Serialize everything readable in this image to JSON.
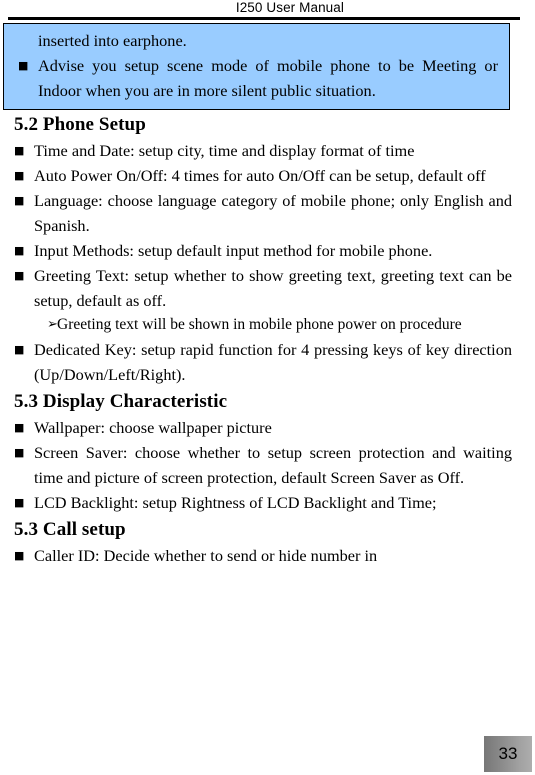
{
  "header": {
    "title": "I250 User Manual"
  },
  "callout": {
    "continuation_text": "inserted into earphone.",
    "bullet_marker": "■",
    "items": [
      "Advise you setup scene mode of mobile phone to be Meeting or Indoor when you are in more silent public situation."
    ]
  },
  "sections": [
    {
      "heading": "5.2 Phone Setup",
      "items": [
        {
          "marker": "■",
          "text": "Time and Date: setup city, time and display format of time"
        },
        {
          "marker": "■",
          "text": "Auto Power On/Off: 4 times for auto On/Off can be setup, default off"
        },
        {
          "marker": "■",
          "text": "Language: choose language category of mobile phone; only English and Spanish."
        },
        {
          "marker": "■",
          "text": "Input Methods: setup default input method for mobile phone."
        },
        {
          "marker": "■",
          "text": "Greeting Text: setup whether to show greeting text, greeting text can be setup, default as off.",
          "subitems": [
            {
              "marker": "➢",
              "text": "Greeting text will be shown in mobile phone power on procedure"
            }
          ]
        },
        {
          "marker": "■",
          "text": "Dedicated Key: setup rapid function for 4 pressing keys of key direction (Up/Down/Left/Right)."
        }
      ]
    },
    {
      "heading": "5.3 Display Characteristic",
      "items": [
        {
          "marker": "■",
          "text": "Wallpaper: choose wallpaper picture"
        },
        {
          "marker": "■",
          "text": "Screen Saver: choose whether to setup screen protection and waiting time and picture of screen protection, default Screen Saver as Off."
        },
        {
          "marker": "■",
          "text": "LCD Backlight: setup Rightness of LCD Backlight and Time;"
        }
      ]
    },
    {
      "heading": "5.3 Call setup",
      "items": [
        {
          "marker": "■",
          "text": "Caller ID: Decide whether to send or hide number in"
        }
      ]
    }
  ],
  "footer": {
    "page_number": "33"
  },
  "colors": {
    "callout_background": "#99ccff",
    "callout_border": "#000000",
    "page_number_gradient_start": "#777777",
    "page_number_gradient_end": "#adadad",
    "text": "#000000"
  }
}
